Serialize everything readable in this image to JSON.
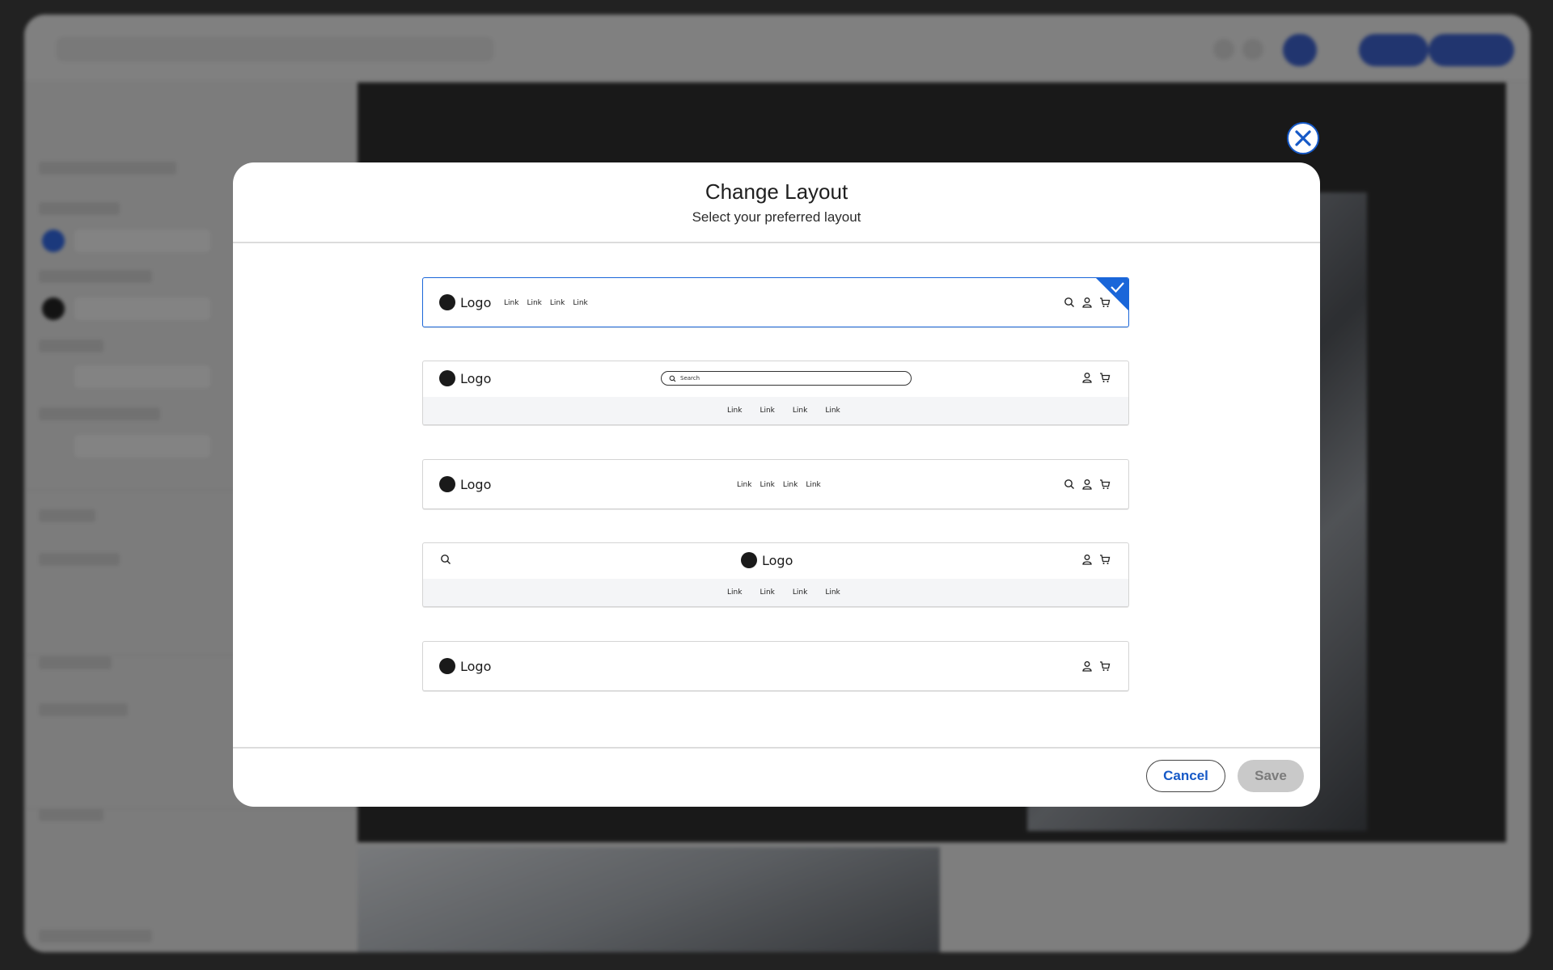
{
  "modal": {
    "title": "Change Layout",
    "subtitle": "Select your preferred layout",
    "cancel_label": "Cancel",
    "save_label": "Save",
    "accent_color": "#1a66d9",
    "close_icon": "close-icon"
  },
  "layout_options": [
    {
      "selected": true,
      "logo": "Logo",
      "links": [
        "Link",
        "Link",
        "Link",
        "Link"
      ],
      "icons": [
        "search-icon",
        "user-icon",
        "cart-icon"
      ]
    },
    {
      "selected": false,
      "logo": "Logo",
      "search_placeholder": "Search",
      "links": [
        "Link",
        "Link",
        "Link",
        "Link"
      ],
      "icons": [
        "user-icon",
        "cart-icon"
      ]
    },
    {
      "selected": false,
      "logo": "Logo",
      "links": [
        "Link",
        "Link",
        "Link",
        "Link"
      ],
      "icons": [
        "search-icon",
        "user-icon",
        "cart-icon"
      ]
    },
    {
      "selected": false,
      "logo": "Logo",
      "links": [
        "Link",
        "Link",
        "Link",
        "Link"
      ],
      "icons": [
        "search-icon",
        "user-icon",
        "cart-icon"
      ]
    },
    {
      "selected": false,
      "logo": "Logo",
      "icons": [
        "user-icon",
        "cart-icon"
      ]
    }
  ]
}
